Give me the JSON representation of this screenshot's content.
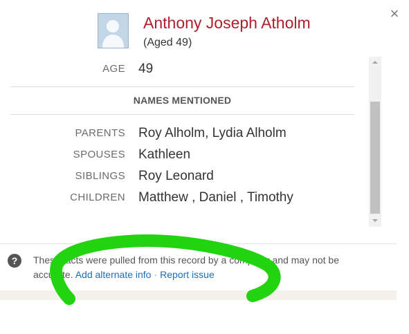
{
  "dialog": {
    "close_glyph": "×"
  },
  "person": {
    "name": "Anthony Joseph Atholm",
    "age_text": "(Aged 49)",
    "avatar_icon": "person-silhouette-icon"
  },
  "facts": {
    "age_label": "AGE",
    "age_value": "49",
    "section_heading": "NAMES MENTIONED",
    "rows": [
      {
        "label": "PARENTS",
        "value": "Roy Alholm, Lydia Alholm"
      },
      {
        "label": "SPOUSES",
        "value": "Kathleen"
      },
      {
        "label": "SIBLINGS",
        "value": "Roy Leonard"
      },
      {
        "label": "CHILDREN",
        "value": "Matthew , Daniel , Timothy"
      }
    ]
  },
  "footer": {
    "help_glyph": "?",
    "notice": "These facts were pulled from this record by a computer and may not be accurate.",
    "add_alternate_link": "Add alternate info",
    "separator": "·",
    "report_link": "Report issue"
  },
  "colors": {
    "name_red": "#b01e2a",
    "link_blue": "#1f6db3",
    "annotation_green": "#22d40f"
  }
}
